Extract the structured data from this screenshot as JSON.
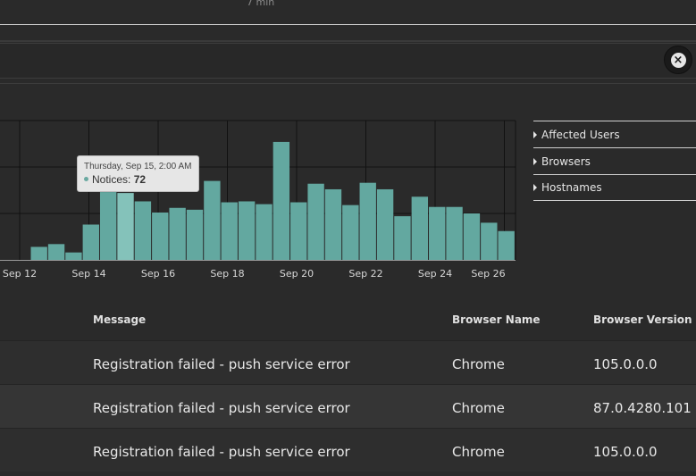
{
  "header": {
    "time_label": "7 min"
  },
  "search": {
    "close_label": "×"
  },
  "chart_data": {
    "type": "bar",
    "series_name": "Notices",
    "x_ticks": [
      "Sep 12",
      "Sep 14",
      "Sep 16",
      "Sep 18",
      "Sep 20",
      "Sep 22",
      "Sep 24",
      "Sep 26"
    ],
    "values": [
      14,
      17,
      8,
      38,
      73,
      72,
      63,
      51,
      56,
      54,
      85,
      62,
      63,
      60,
      127,
      62,
      82,
      76,
      59,
      83,
      76,
      47,
      68,
      57,
      57,
      50,
      40,
      31
    ],
    "ylim": [
      0,
      150
    ],
    "highlight_index": 5,
    "bar_color": "#63a8a0",
    "highlight_color": "#84c2ba"
  },
  "tooltip": {
    "date": "Thursday, Sep 15, 2:00 AM",
    "label": "Notices:",
    "value": "72"
  },
  "facets": [
    "Affected Users",
    "Browsers",
    "Hostnames"
  ],
  "table": {
    "columns": [
      "Message",
      "Browser Name",
      "Browser Version"
    ],
    "rows": [
      [
        "Registration failed - push service error",
        "Chrome",
        "105.0.0.0"
      ],
      [
        "Registration failed - push service error",
        "Chrome",
        "87.0.4280.101"
      ],
      [
        "Registration failed - push service error",
        "Chrome",
        "105.0.0.0"
      ]
    ]
  }
}
